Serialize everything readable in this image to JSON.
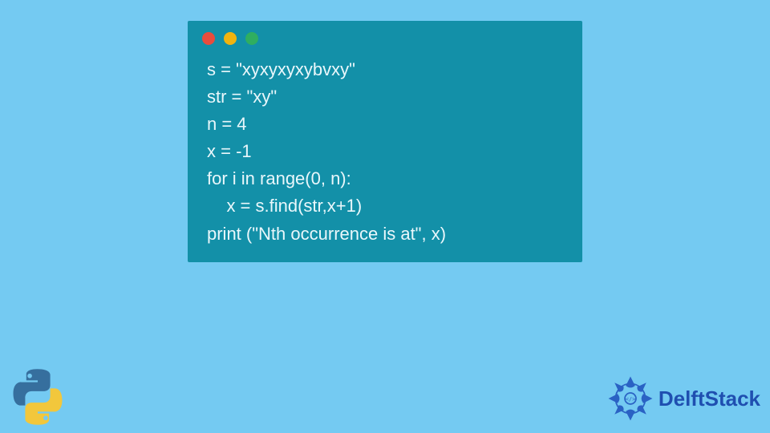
{
  "code": {
    "lines": [
      "s = \"xyxyxyxybvxy\"",
      "str = \"xy\"",
      "n = 4",
      "x = -1",
      "for i in range(0, n):",
      "    x = s.find(str,x+1)",
      "print (\"Nth occurrence is at\", x)"
    ]
  },
  "window": {
    "buttons": [
      "close",
      "minimize",
      "maximize"
    ]
  },
  "branding": {
    "site_name": "DelftStack",
    "language_icon": "python"
  },
  "colors": {
    "background": "#74caf2",
    "window": "#1390a8",
    "text": "#e9f7fb",
    "brand": "#1f4fb0"
  }
}
